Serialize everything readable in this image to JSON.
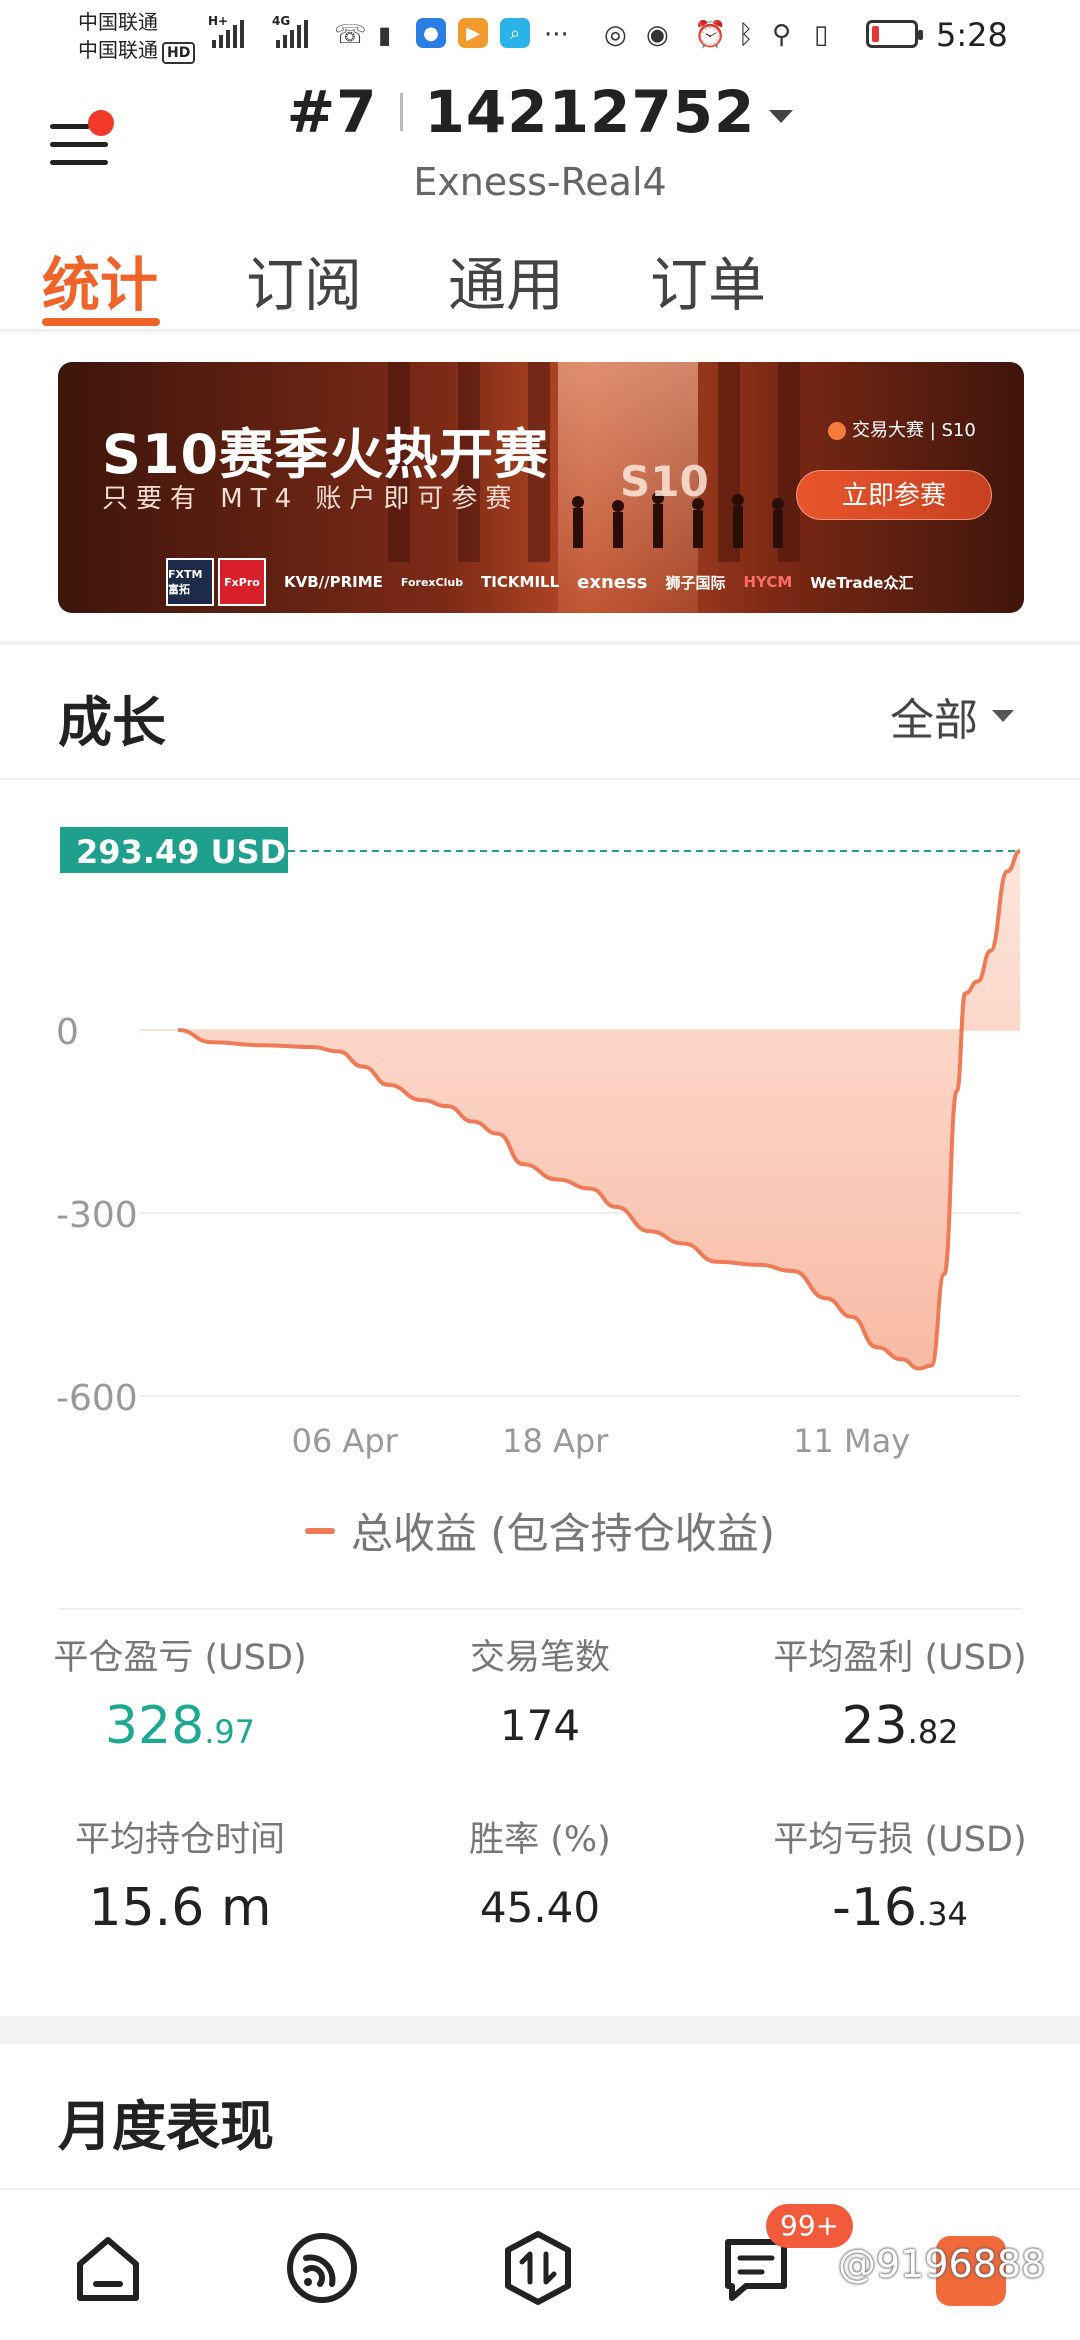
{
  "status_bar": {
    "carrier1": "中国联通",
    "carrier2": "中国联通",
    "hd": "HD",
    "net1": "H+",
    "net2": "4G",
    "more": "···",
    "time": "5:28"
  },
  "header": {
    "account_prefix": "#7",
    "account_number": "14212752",
    "server": "Exness-Real4"
  },
  "tabs": [
    {
      "label": "统计",
      "active": true
    },
    {
      "label": "订阅",
      "active": false
    },
    {
      "label": "通用",
      "active": false
    },
    {
      "label": "订单",
      "active": false
    }
  ],
  "banner": {
    "title": "S10赛季火热开赛",
    "subtitle": "只要有 MT4 账户即可参赛",
    "brand": "交易大赛 | S10",
    "mark": "S10",
    "cta": "立即参赛",
    "sponsors": [
      "FXTM 富拓",
      "FxPro",
      "KVB//PRIME",
      "ForexClub",
      "TICKMILL",
      "exness",
      "狮子国际",
      "HYCM",
      "WeTrade众汇"
    ]
  },
  "growth": {
    "title": "成长",
    "filter": "全部"
  },
  "chart_data": {
    "type": "area",
    "current_label": "293.49 USD",
    "current_value": 293.49,
    "ylim": [
      -600,
      300
    ],
    "yticks": [
      0,
      -300,
      -600
    ],
    "ytick_labels": [
      "0",
      "-300",
      "-600"
    ],
    "xtick_labels": [
      "06 Apr",
      "18 Apr",
      "11 May"
    ],
    "legend": "总收益 (包含持仓收益)",
    "colors": {
      "line": "#ef7a55",
      "fill": "#f7b39a",
      "marker": "#1ea08c"
    },
    "series": [
      {
        "name": "总收益 (包含持仓收益)",
        "points": [
          [
            0,
            0
          ],
          [
            0.04,
            -20
          ],
          [
            0.1,
            -25
          ],
          [
            0.16,
            -28
          ],
          [
            0.19,
            -35
          ],
          [
            0.22,
            -60
          ],
          [
            0.25,
            -90
          ],
          [
            0.29,
            -115
          ],
          [
            0.32,
            -125
          ],
          [
            0.35,
            -150
          ],
          [
            0.38,
            -170
          ],
          [
            0.41,
            -220
          ],
          [
            0.45,
            -245
          ],
          [
            0.49,
            -260
          ],
          [
            0.52,
            -290
          ],
          [
            0.56,
            -330
          ],
          [
            0.6,
            -350
          ],
          [
            0.64,
            -380
          ],
          [
            0.69,
            -385
          ],
          [
            0.73,
            -395
          ],
          [
            0.77,
            -440
          ],
          [
            0.8,
            -470
          ],
          [
            0.83,
            -520
          ],
          [
            0.86,
            -540
          ],
          [
            0.88,
            -555
          ],
          [
            0.895,
            -550
          ],
          [
            0.91,
            -400
          ],
          [
            0.925,
            -100
          ],
          [
            0.935,
            60
          ],
          [
            0.95,
            80
          ],
          [
            0.965,
            130
          ],
          [
            0.985,
            260
          ],
          [
            1.0,
            293.49
          ]
        ]
      }
    ]
  },
  "stats": [
    {
      "label": "平仓盈亏 (USD)",
      "int": "328",
      "dec": ".97",
      "style": "green"
    },
    {
      "label": "交易笔数",
      "int": "174",
      "dec": "",
      "style": "plain"
    },
    {
      "label": "平均盈利 (USD)",
      "int": "23",
      "dec": ".82",
      "style": "normal"
    },
    {
      "label": "平均持仓时间",
      "int": "15.6 m",
      "dec": "",
      "style": "normal"
    },
    {
      "label": "胜率 (%)",
      "int": "45.40",
      "dec": "",
      "style": "plain"
    },
    {
      "label": "平均亏损 (USD)",
      "int": "-16",
      "dec": ".34",
      "style": "normal"
    }
  ],
  "monthly": {
    "title": "月度表现"
  },
  "bottom_nav": {
    "badge": "99+",
    "watermark": "@9196888"
  }
}
